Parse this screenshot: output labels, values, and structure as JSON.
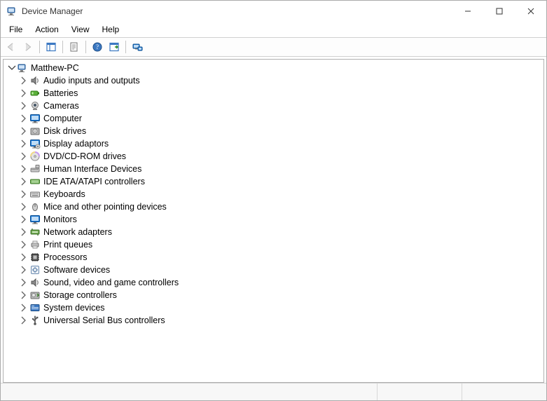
{
  "window": {
    "title": "Device Manager"
  },
  "menu": {
    "file": "File",
    "action": "Action",
    "view": "View",
    "help": "Help"
  },
  "tree": {
    "root": {
      "label": "Matthew-PC",
      "expanded": true
    },
    "children": [
      {
        "id": "audio",
        "label": "Audio inputs and outputs"
      },
      {
        "id": "batteries",
        "label": "Batteries"
      },
      {
        "id": "cameras",
        "label": "Cameras"
      },
      {
        "id": "computer",
        "label": "Computer"
      },
      {
        "id": "disk",
        "label": "Disk drives"
      },
      {
        "id": "display",
        "label": "Display adaptors"
      },
      {
        "id": "dvd",
        "label": "DVD/CD-ROM drives"
      },
      {
        "id": "hid",
        "label": "Human Interface Devices"
      },
      {
        "id": "ide",
        "label": "IDE ATA/ATAPI controllers"
      },
      {
        "id": "keyboards",
        "label": "Keyboards"
      },
      {
        "id": "mice",
        "label": "Mice and other pointing devices"
      },
      {
        "id": "monitors",
        "label": "Monitors"
      },
      {
        "id": "network",
        "label": "Network adapters"
      },
      {
        "id": "print",
        "label": "Print queues"
      },
      {
        "id": "processors",
        "label": "Processors"
      },
      {
        "id": "software",
        "label": "Software devices"
      },
      {
        "id": "sound",
        "label": "Sound, video and game controllers"
      },
      {
        "id": "storage",
        "label": "Storage controllers"
      },
      {
        "id": "system",
        "label": "System devices"
      },
      {
        "id": "usb",
        "label": "Universal Serial Bus controllers"
      }
    ]
  }
}
